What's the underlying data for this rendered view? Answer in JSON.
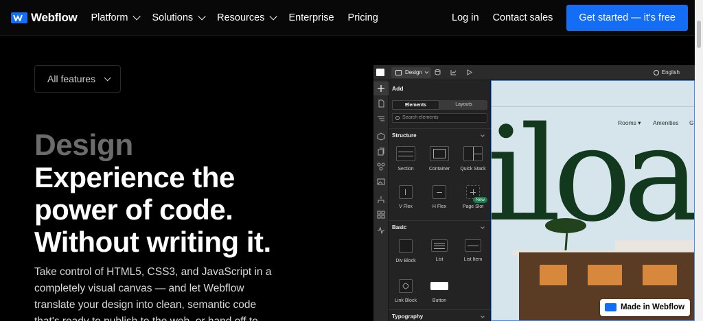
{
  "nav": {
    "logo_text": "Webflow",
    "items": [
      "Platform",
      "Solutions",
      "Resources",
      "Enterprise",
      "Pricing"
    ],
    "login": "Log in",
    "contact": "Contact sales",
    "cta": "Get started — it's free"
  },
  "hero": {
    "features_label": "All features",
    "eyebrow": "Design",
    "headline": "Experience the power of code. Without writing it.",
    "body": "Take control of HTML5, CSS3, and JavaScript in a completely visual canvas — and let Webflow translate your design into clean, semantic code that's ready to publish to the web, or hand off to"
  },
  "designer": {
    "mode": "Design",
    "language": "English",
    "panel_title": "Add",
    "tabs": [
      "Elements",
      "Layouts"
    ],
    "search_placeholder": "Search elements",
    "sections": {
      "structure": "Structure",
      "basic": "Basic",
      "typography": "Typography"
    },
    "structure_items": [
      "Section",
      "Container",
      "Quick Stack",
      "V Flex",
      "H Flex",
      "Page Slot"
    ],
    "basic_items": [
      "Div Block",
      "List",
      "List Item",
      "Link Block",
      "Button"
    ],
    "new_badge": "New",
    "canvas": {
      "nav_items": [
        "Rooms",
        "Amenities",
        "G"
      ],
      "big_text": "iloa"
    }
  },
  "badge": {
    "made_in": "Made in Webflow"
  },
  "colors": {
    "brand": "#146ef5",
    "canvas_bg": "#d6e4ec",
    "headline_dim": "#6b6b6b"
  }
}
